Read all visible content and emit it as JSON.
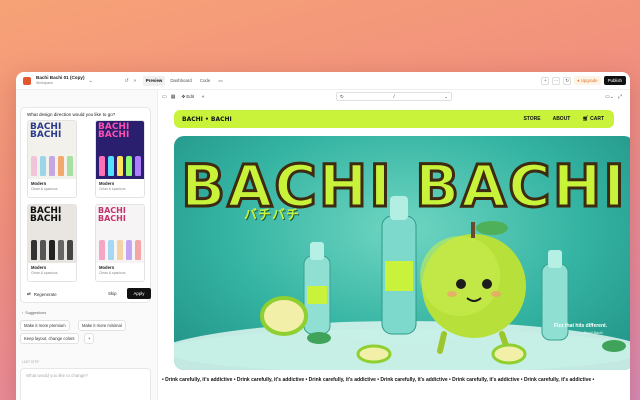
{
  "topbar": {
    "project_title": "Bachi Bachi 01 (Copy)",
    "project_sub": "Workspace",
    "tabs": [
      "Preview",
      "Dashboard",
      "Code"
    ],
    "upgrade_label": "Upgrade",
    "publish_label": "Publish"
  },
  "panel": {
    "question": "What design direction would you like to go?",
    "options": [
      {
        "thumb_title": "BACHI\nBACHI",
        "name": "Modern",
        "desc": "Clean & spacious"
      },
      {
        "thumb_title": "BACHI\nBACHI",
        "name": "Modern",
        "desc": "Clean & spacious"
      },
      {
        "thumb_title": "BACHI\nBACHI",
        "name": "Modern",
        "desc": "Clean & spacious"
      },
      {
        "thumb_title": "BACHI\nBACHI",
        "name": "Modern",
        "desc": "Clean & spacious"
      }
    ],
    "regenerate_label": "Regenerate",
    "skip_label": "Skip",
    "apply_label": "Apply",
    "suggestions_label": "Suggestions",
    "suggestions": [
      "Make it more premium",
      "Make it more minimal",
      "Keep layout, change colors",
      "+"
    ],
    "last_step": "LAST STEP",
    "prompt_placeholder": "What would you like to change?"
  },
  "preview": {
    "edit_label": "Edit",
    "url": "/",
    "site": {
      "brand": "BACHI • BACHI",
      "nav": [
        "STORE",
        "ABOUT",
        "CART"
      ],
      "hero_title": "BACHI BACHI",
      "hero_jp": "バチバチ",
      "tagline": "Fizz that hits different.",
      "tagline_sub": "— Bachi Bachi",
      "ticker": "• Drink carefully, it's addictive • Drink carefully, it's addictive • Drink carefully, it's addictive • Drink carefully, it's addictive • Drink carefully, it's addictive • Drink carefully, it's addictive •"
    }
  },
  "colors": {
    "accent": "#c9f33b",
    "brand_orange": "#e4572e",
    "publish_bg": "#111111"
  }
}
